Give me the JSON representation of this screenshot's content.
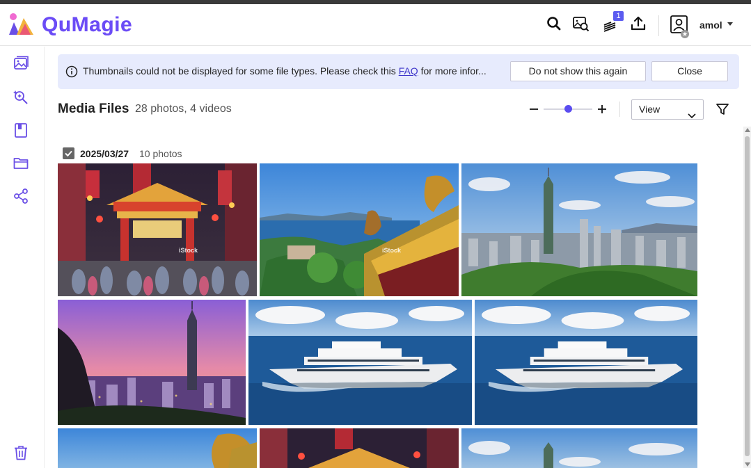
{
  "header": {
    "logo_text": "QuMagie",
    "notification_count": "1",
    "user_name": "amol",
    "icons": [
      "search-icon",
      "face-search-icon",
      "task-list-icon",
      "upload-icon",
      "user-avatar-icon"
    ]
  },
  "sidebar": {
    "items": [
      "photos-icon",
      "smart-album-icon",
      "album-icon",
      "folder-icon",
      "share-icon",
      "trash-icon"
    ]
  },
  "notice": {
    "text_before": "Thumbnails could not be displayed for some file types. Please check this ",
    "link": "FAQ",
    "text_after": " for more infor...",
    "dismiss_label": "Do not show this again",
    "close_label": "Close"
  },
  "toolbar": {
    "title": "Media Files",
    "summary": "28 photos, 4 videos",
    "view_label": "View"
  },
  "group": {
    "date": "2025/03/27",
    "count": "10 photos"
  },
  "photos": [
    {
      "subject": "temple gate night market",
      "watermark": "iStock"
    },
    {
      "subject": "coastal temple roof",
      "watermark": "iStock"
    },
    {
      "subject": "city skyline taipei 101 day"
    },
    {
      "subject": "city skyline taipei 101 sunset"
    },
    {
      "subject": "yacht on sea"
    },
    {
      "subject": "yacht on sea"
    },
    {
      "subject": "coastal temple roof"
    },
    {
      "subject": "temple gate night market"
    },
    {
      "subject": "city skyline taipei 101 day"
    }
  ],
  "colors": {
    "accent": "#5a4cf0",
    "notice_bg": "#e7ebfd",
    "icon_purple": "#6a4fe6"
  }
}
